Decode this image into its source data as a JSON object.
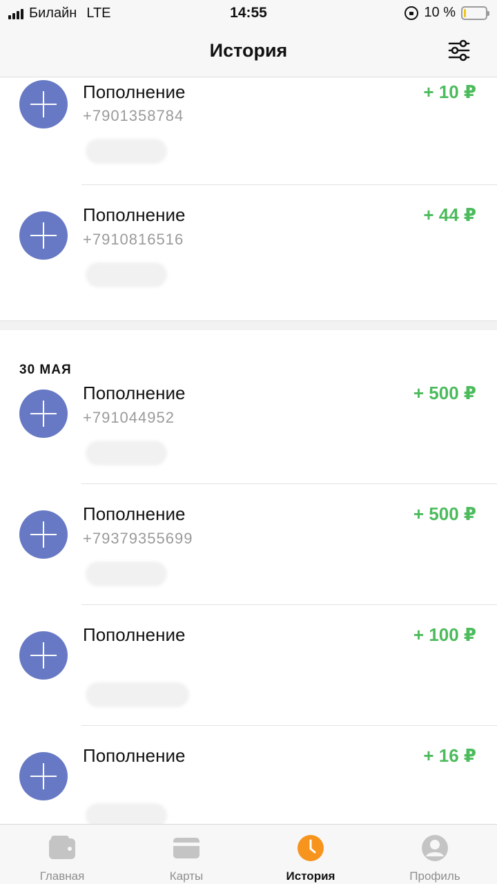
{
  "status_bar": {
    "carrier": "Билайн",
    "network": "LTE",
    "time": "14:55",
    "battery": "10 %",
    "battery_level": 0.1
  },
  "header": {
    "title": "История",
    "filter_icon": "sliders-icon"
  },
  "sections": [
    {
      "date": "",
      "items": [
        {
          "title": "Пополнение",
          "phone": "+7901358784",
          "amount": "+ 10 ₽"
        },
        {
          "title": "Пополнение",
          "phone": "+7910816516",
          "amount": "+ 44 ₽"
        }
      ]
    },
    {
      "date": "30 МАЯ",
      "items": [
        {
          "title": "Пополнение",
          "phone": "+791044952",
          "amount": "+ 500 ₽"
        },
        {
          "title": "Пополнение",
          "phone": "+79379355699",
          "amount": "+ 500 ₽"
        },
        {
          "title": "Пополнение",
          "phone": "",
          "amount": "+ 100 ₽"
        },
        {
          "title": "Пополнение",
          "phone": "",
          "amount": "+ 16 ₽"
        }
      ]
    }
  ],
  "colors": {
    "accent": "#f7941d",
    "income": "#4cbb5c",
    "topup_icon": "#6779c4"
  },
  "tabbar": {
    "tabs": [
      {
        "label": "Главная",
        "icon": "wallet-icon"
      },
      {
        "label": "Карты",
        "icon": "card-icon"
      },
      {
        "label": "История",
        "icon": "clock-icon",
        "active": true
      },
      {
        "label": "Профиль",
        "icon": "user-icon"
      }
    ]
  }
}
